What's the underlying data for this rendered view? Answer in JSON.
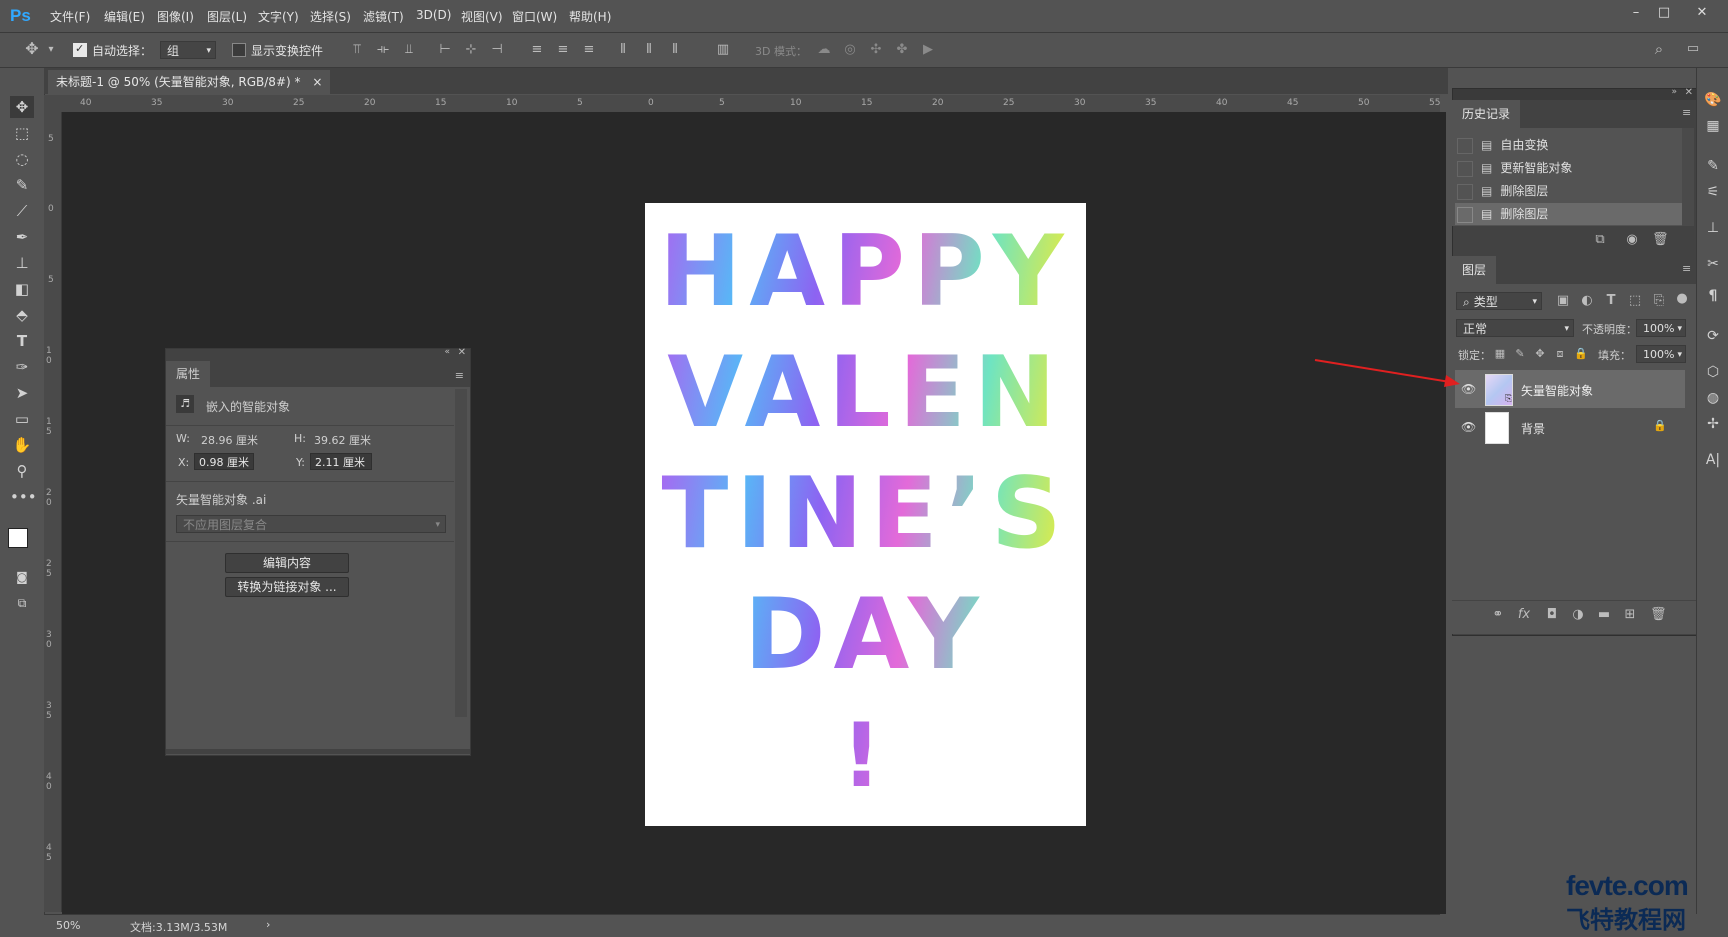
{
  "app": {
    "logo": "Ps"
  },
  "menu": [
    "文件(F)",
    "编辑(E)",
    "图像(I)",
    "图层(L)",
    "文字(Y)",
    "选择(S)",
    "滤镜(T)",
    "3D(D)",
    "视图(V)",
    "窗口(W)",
    "帮助(H)"
  ],
  "options": {
    "auto_select_label": "自动选择：",
    "auto_select_value": "组",
    "show_transform_label": "显示变换控件",
    "mode3d_label": "3D 模式："
  },
  "document": {
    "tab_title": "未标题-1 @ 50% (矢量智能对象, RGB/8#) *",
    "close": "×",
    "artwork_lines": [
      "HAPPY",
      "VALEN",
      "TINE’S",
      "DAY",
      "!"
    ]
  },
  "rulers": {
    "top": [
      "40",
      "35",
      "30",
      "25",
      "20",
      "15",
      "10",
      "5",
      "0",
      "5",
      "10",
      "15",
      "20",
      "25",
      "30",
      "35",
      "40",
      "45",
      "50",
      "55"
    ],
    "left": [
      "5",
      "0",
      "5",
      "1 0",
      "1 5",
      "2 0",
      "2 5",
      "3 0",
      "3 5",
      "4 0",
      "4 5"
    ]
  },
  "properties": {
    "tab": "属性",
    "title": "嵌入的智能对象",
    "w_label": "W:",
    "w_value": "28.96 厘米",
    "h_label": "H:",
    "h_value": "39.62 厘米",
    "x_label": "X:",
    "x_value": "0.98 厘米",
    "y_label": "Y:",
    "y_value": "2.11 厘米",
    "file": "矢量智能对象 .ai",
    "comp_placeholder": "不应用图层复合",
    "edit_btn": "编辑内容",
    "convert_btn": "转换为链接对象 ..."
  },
  "history": {
    "tab": "历史记录",
    "items": [
      "自由变换",
      "更新智能对象",
      "删除图层",
      "删除图层"
    ]
  },
  "layers": {
    "tab": "图层",
    "filter": "类型",
    "blend": "正常",
    "opacity_label": "不透明度：",
    "opacity_value": "100%",
    "lock_label": "锁定：",
    "fill_label": "填充：",
    "fill_value": "100%",
    "items": [
      {
        "name": "矢量智能对象",
        "selected": true
      },
      {
        "name": "背景",
        "selected": false
      }
    ]
  },
  "status": {
    "zoom": "50%",
    "doc": "文档:3.13M/3.53M",
    "arrow": "›"
  },
  "watermark": {
    "line1": "fevte.com",
    "line2": "飞特教程网"
  },
  "colors": {
    "accent": "#31a8ff",
    "canvas_bg": "#282828",
    "panel_bg": "#535353",
    "annotation_arrow": "#e02020"
  }
}
